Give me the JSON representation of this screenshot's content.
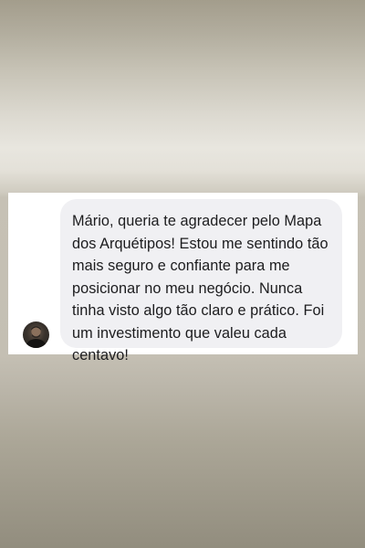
{
  "message": {
    "sender_avatar": "user-avatar",
    "text": "Mário, queria te agradecer pelo Mapa dos Arquétipos! Estou me sentindo tão mais seguro e confiante para me posicionar no meu negócio. Nunca tinha visto algo tão claro e prático. Foi um investimento que valeu cada centavo!"
  },
  "colors": {
    "bubble": "#f0f0f3",
    "text": "#1c1c1e",
    "panel": "#ffffff"
  }
}
